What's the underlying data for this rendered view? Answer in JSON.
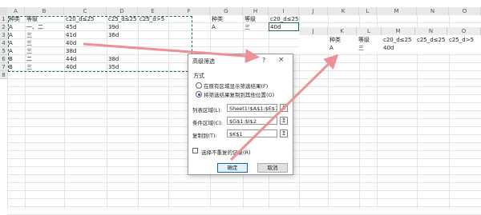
{
  "columns": [
    "A",
    "B",
    "C",
    "D",
    "E",
    "F",
    "G",
    "H",
    "I",
    "J",
    "K",
    "L",
    "M",
    "N",
    "O"
  ],
  "rows": [
    "1",
    "2",
    "3",
    "4",
    "5",
    "6",
    "7",
    "8"
  ],
  "table": {
    "headers": [
      "种类",
      "等级",
      "c20_d≤25",
      "c25_d≤25",
      "c25_d>5"
    ],
    "rows": [
      [
        "A",
        "一、二",
        "45d",
        "39d",
        ""
      ],
      [
        "A",
        "三",
        "41d",
        "36d",
        ""
      ],
      [
        "A",
        "三",
        "40d",
        "",
        ""
      ],
      [
        "A",
        "三",
        "38d",
        "",
        ""
      ],
      [
        "B",
        "二",
        "44d",
        "38d",
        ""
      ],
      [
        "B",
        "三",
        "40d",
        "35d",
        ""
      ]
    ]
  },
  "criteria": {
    "headers": [
      "种类",
      "等级",
      "c20_d≤25"
    ],
    "values": [
      "A",
      "三",
      "40d"
    ]
  },
  "output": {
    "col_headers": [
      "J",
      "K",
      "L",
      "M",
      "N",
      "O"
    ],
    "headers": [
      "种类",
      "等级",
      "c20_d≤25",
      "c25_d≤25",
      "c25_d>5"
    ],
    "values": [
      "A",
      "三",
      "40d"
    ]
  },
  "dialog": {
    "title": "高级筛选",
    "help": "?",
    "close": "×",
    "section": "方式",
    "option1": "在原有区域显示筛选结果(F)",
    "option2": "将筛选结果复制到其他位置(O)",
    "list_label": "列表区域(L):",
    "list_value": "Sheet1!$A$1:$E$7",
    "criteria_label": "条件区域(C):",
    "criteria_value": "$G$1:$I$2",
    "copy_label": "复制到(T):",
    "copy_value": "$K$1",
    "unique_label": "选择不重复的记录(R)",
    "ok_label": "确定",
    "cancel_label": "取消",
    "pick_icon": "↥"
  },
  "colors": {
    "arrow": "#ef8f96",
    "marquee": "#1e7145"
  }
}
